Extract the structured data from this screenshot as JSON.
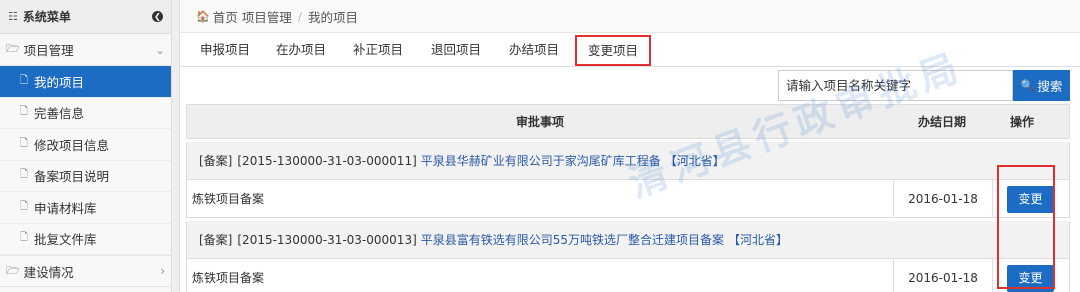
{
  "sidebar": {
    "title": "系统菜单",
    "groups": [
      {
        "label": "项目管理"
      },
      {
        "label": "建设情况"
      }
    ],
    "items": [
      {
        "label": "我的项目"
      },
      {
        "label": "完善信息"
      },
      {
        "label": "修改项目信息"
      },
      {
        "label": "备案项目说明"
      },
      {
        "label": "申请材料库"
      },
      {
        "label": "批复文件库"
      }
    ]
  },
  "breadcrumb": {
    "home": "首页",
    "section": "项目管理",
    "current": "我的项目"
  },
  "tabs": [
    {
      "label": "申报项目"
    },
    {
      "label": "在办项目"
    },
    {
      "label": "补正项目"
    },
    {
      "label": "退回项目"
    },
    {
      "label": "办结项目"
    },
    {
      "label": "变更项目"
    }
  ],
  "search": {
    "input_value": "请输入项目名称关键字",
    "button_label": "搜索"
  },
  "table": {
    "headers": {
      "item": "审批事项",
      "date": "办结日期",
      "action": "操作"
    },
    "groups": [
      {
        "type": "[备案]",
        "code": "[2015-130000-31-03-000011]",
        "project": "平泉县华赫矿业有限公司于家沟尾矿库工程备",
        "province": "【河北省】",
        "row": {
          "name": "炼铁项目备案",
          "date": "2016-01-18",
          "action": "变更"
        }
      },
      {
        "type": "[备案]",
        "code": "[2015-130000-31-03-000013]",
        "project": "平泉县富有铁选有限公司55万吨铁选厂整合迁建项目备案",
        "province": "【河北省】",
        "row": {
          "name": "炼铁项目备案",
          "date": "2016-01-18",
          "action": "变更"
        }
      }
    ]
  },
  "watermark": "清河县行政审批局",
  "colors": {
    "accent": "#1c6cc3",
    "highlight": "#e03030",
    "link": "#2a5aa5"
  }
}
